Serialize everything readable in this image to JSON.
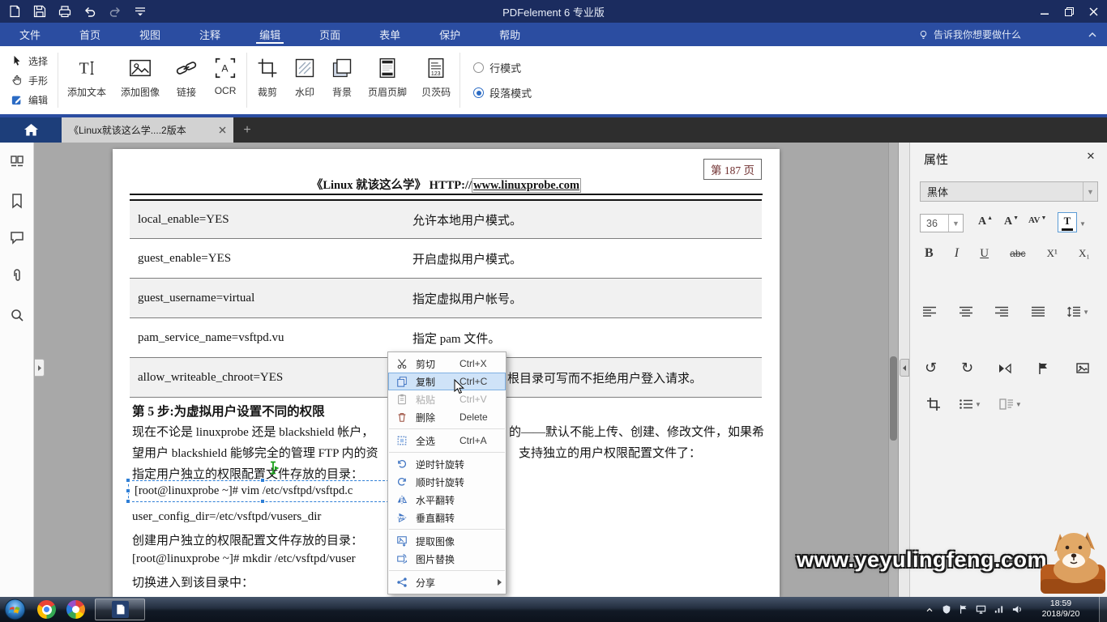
{
  "titlebar": {
    "title": "PDFelement 6 专业版"
  },
  "menubar": {
    "items": [
      "文件",
      "首页",
      "视图",
      "注释",
      "编辑",
      "页面",
      "表单",
      "保护",
      "帮助"
    ],
    "assistant_hint": "告诉我你想要做什么"
  },
  "ribbon": {
    "small_tools": [
      "选择",
      "手形",
      "编辑"
    ],
    "large_tools": [
      "添加文本",
      "添加图像",
      "链接",
      "OCR",
      "裁剪",
      "水印",
      "背景",
      "页眉页脚",
      "贝茨码"
    ],
    "modes": [
      {
        "label": "行模式",
        "selected": false
      },
      {
        "label": "段落模式",
        "selected": true
      }
    ]
  },
  "tabbar": {
    "active_tab_title": "《Linux就该这么学....2版本"
  },
  "document": {
    "page_badge": "第 187 页",
    "header_prefix": "《Linux 就该这么学》 HTTP://",
    "header_link": "www.linuxprobe.com",
    "table_rows": [
      {
        "param": "local_enable=YES",
        "desc": "允许本地用户模式。"
      },
      {
        "param": "guest_enable=YES",
        "desc": "开启虚拟用户模式。"
      },
      {
        "param": "guest_username=virtual",
        "desc": "指定虚拟用户帐号。"
      },
      {
        "param": "pam_service_name=vsftpd.vu",
        "desc": "指定 pam 文件。"
      },
      {
        "param": "allow_writeable_chroot=YES",
        "desc": "根目录可写而不拒绝用户登入请求。"
      }
    ],
    "step_heading": "第 5 步:为虚拟用户设置不同的权限",
    "para_line1_left": "现在不论是 linuxprobe 还是 blackshield 帐户，",
    "para_line1_right": "的——默认不能上传、创建、修改文件，如果希",
    "para_line2_left": "望用户 blackshield 能够完全的管理 FTP 内的资",
    "para_line2_right": "支持独立的用户权限配置文件了：",
    "line_specify_dir": "指定用户独立的权限配置文件存放的目录：",
    "selected_command": "[root@linuxprobe ~]# vim /etc/vsftpd/vsftpd.c",
    "config_line": "user_config_dir=/etc/vsftpd/vusers_dir",
    "line_create_dir": "创建用户独立的权限配置文件存放的目录：",
    "mkdir_command": "[root@linuxprobe ~]# mkdir /etc/vsftpd/vuser",
    "line_cd": "切换进入到该目录中："
  },
  "context_menu": {
    "items": [
      {
        "label": "剪切",
        "shortcut": "Ctrl+X"
      },
      {
        "label": "复制",
        "shortcut": "Ctrl+C"
      },
      {
        "label": "粘贴",
        "shortcut": "Ctrl+V"
      },
      {
        "label": "删除",
        "shortcut": "Delete"
      },
      {
        "label": "全选",
        "shortcut": "Ctrl+A"
      },
      {
        "label": "逆时针旋转"
      },
      {
        "label": "顺时针旋转"
      },
      {
        "label": "水平翻转"
      },
      {
        "label": "垂直翻转"
      },
      {
        "label": "提取图像"
      },
      {
        "label": "图片替换"
      },
      {
        "label": "分享"
      }
    ]
  },
  "properties_panel": {
    "title": "属性",
    "font_name": "黑体",
    "font_size": "36",
    "bold": "B",
    "italic": "I",
    "underline": "U",
    "strikethrough": "abc",
    "superscript": "X¹",
    "subscript": "X₁"
  },
  "overlay": {
    "watermark": "www.yeyulingfeng.com"
  },
  "taskbar": {
    "time": "18:59",
    "date": "2018/9/20"
  },
  "colors": {
    "titlebar": "#1b2c5f",
    "menubar": "#2b4da1",
    "accent_blue": "#2b6bc4",
    "menu_highlight": "#cfe3f8",
    "doc_background": "#a8a8a8"
  }
}
